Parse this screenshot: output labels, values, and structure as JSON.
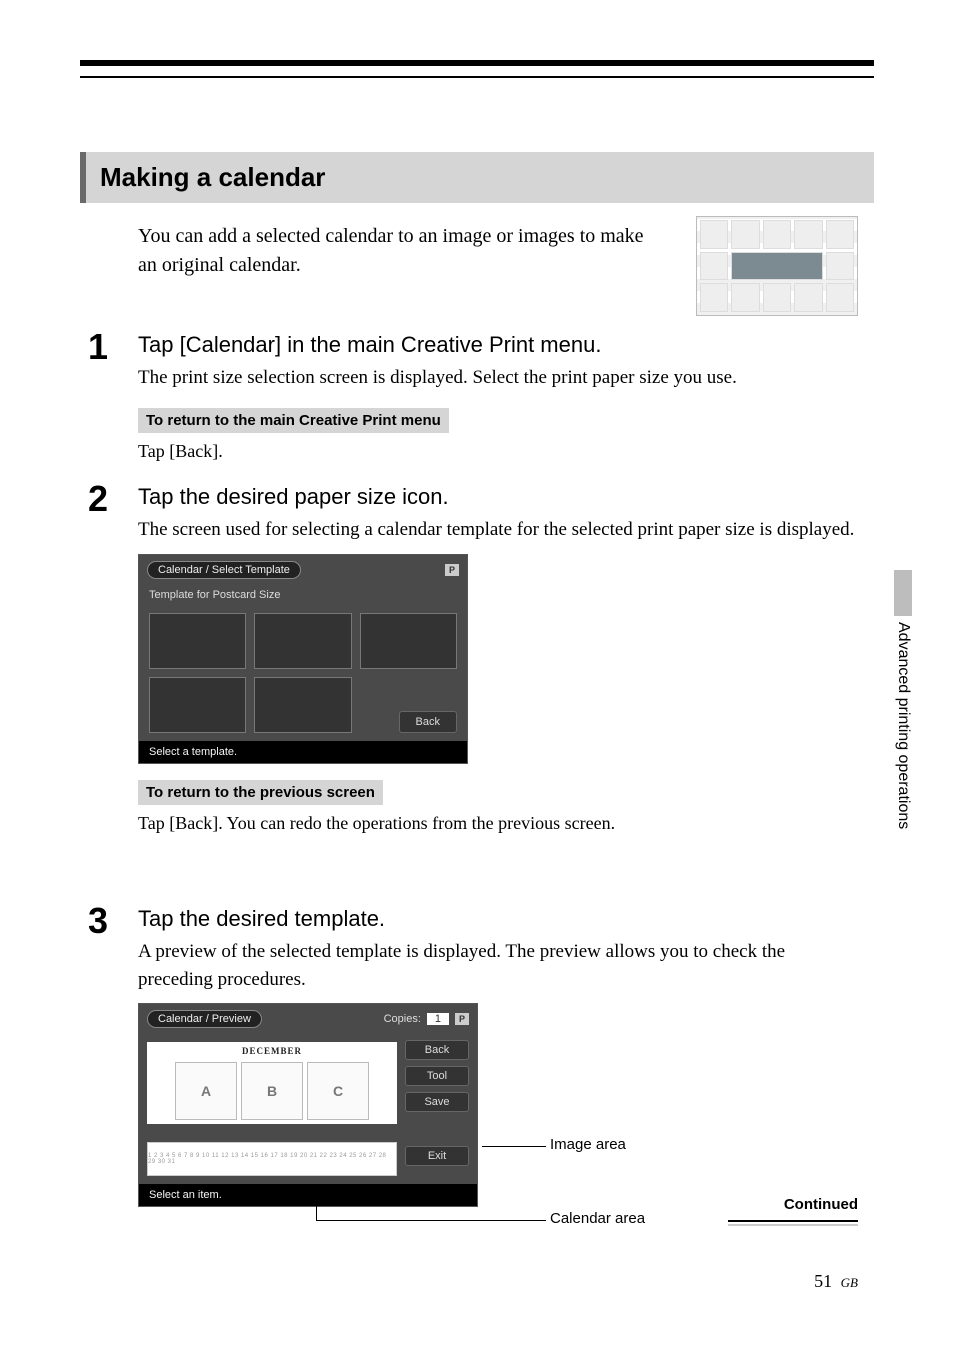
{
  "section_title": "Making a calendar",
  "intro": "You can add a selected calendar to an image or images to make an original calendar.",
  "steps": {
    "s1": {
      "num": "1",
      "heading": "Tap [Calendar] in the main Creative Print menu.",
      "body": "The print size selection screen is displayed. Select the print paper size you use.",
      "note_title": "To return to the main Creative Print menu",
      "note_body": "Tap [Back]."
    },
    "s2": {
      "num": "2",
      "heading": "Tap the desired paper size icon.",
      "body": "The screen used for selecting a calendar template for the selected print paper size is displayed.",
      "note_title": "To return to the previous screen",
      "note_body": "Tap [Back].  You can redo the operations from the previous screen."
    },
    "s3": {
      "num": "3",
      "heading": "Tap the desired template.",
      "body": "A preview of the selected template is displayed.  The preview allows you to check the preceding procedures."
    }
  },
  "screenshot1": {
    "breadcrumb": "Calendar / Select Template",
    "badge": "P",
    "subtitle": "Template for Postcard Size",
    "back": "Back",
    "footer": "Select a template."
  },
  "screenshot2": {
    "breadcrumb": "Calendar / Preview",
    "copies_label": "Copies:",
    "copies_value": "1",
    "badge": "P",
    "month": "DECEMBER",
    "slotA": "A",
    "slotB": "B",
    "slotC": "C",
    "buttons": {
      "back": "Back",
      "tool": "Tool",
      "save": "Save",
      "exit": "Exit"
    },
    "footer": "Select an item."
  },
  "labels": {
    "image_area": "Image area",
    "calendar_area": "Calendar area"
  },
  "side_tab": "Advanced printing operations",
  "continued": "Continued",
  "page": {
    "num": "51",
    "suffix": "GB"
  }
}
